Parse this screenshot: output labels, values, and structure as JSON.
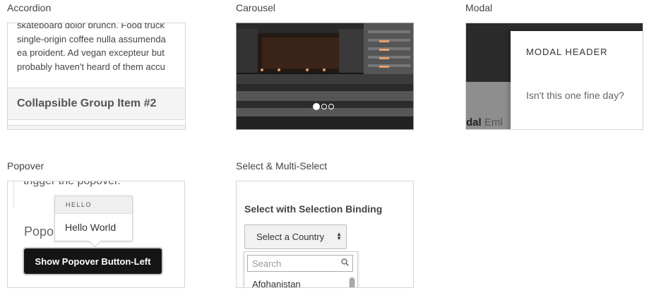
{
  "sections": {
    "accordion": "Accordion",
    "carousel": "Carousel",
    "modal": "Modal",
    "popover": "Popover",
    "select": "Select & Multi-Select"
  },
  "accordion": {
    "body_lines": [
      "skateboard dolor brunch. Food truck",
      "single-origin coffee nulla assumenda",
      "ea proident. Ad vegan excepteur but",
      "probably haven't heard of them accu"
    ],
    "group_title": "Collapsible Group Item #2"
  },
  "carousel": {
    "slide_count": 3,
    "active_index": 0
  },
  "modal": {
    "background_text_bold": "dal",
    "background_text_rest": "Eml",
    "header": "MODAL HEADER",
    "body": "Isn't this one fine day?"
  },
  "popover": {
    "top_text": "trigger the popover.",
    "background_text": "Popo",
    "title": "HELLO",
    "content": "Hello World",
    "button_label": "Show Popover Button-Left"
  },
  "select": {
    "heading": "Select with Selection Binding",
    "selected_label": "Select a Country",
    "search_placeholder": "Search",
    "first_option": "Afghanistan"
  },
  "colors": {
    "button_dark": "#151515",
    "carousel_bg": "#1a1a1a"
  }
}
